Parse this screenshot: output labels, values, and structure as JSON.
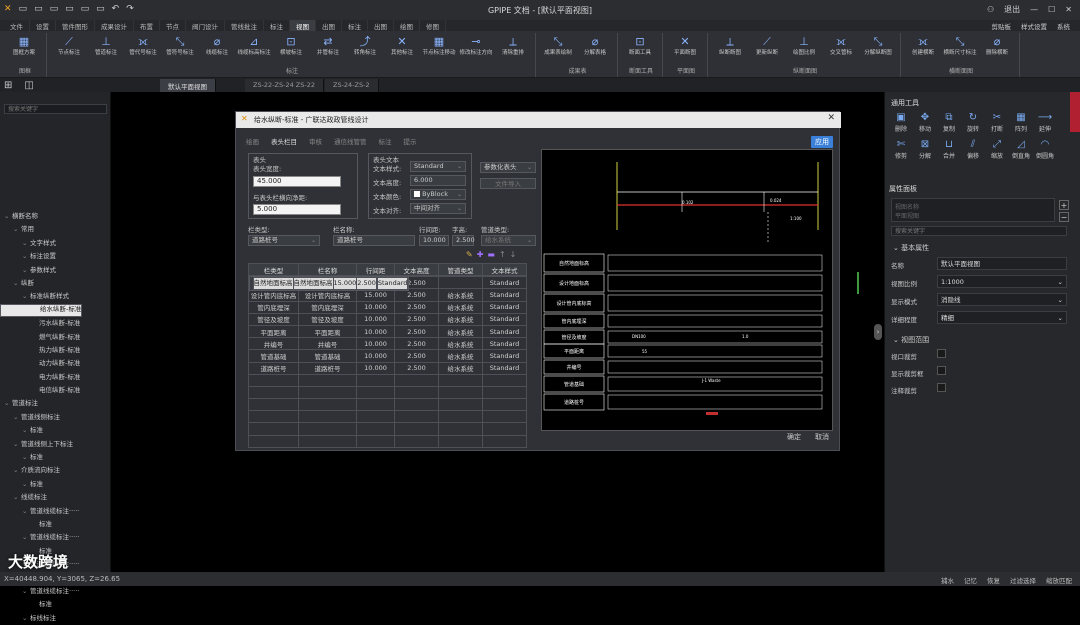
{
  "app": {
    "title": "GPIPE 文档 - [默认平面视图]",
    "logout": "退出",
    "shortcut": "剪贴板",
    "style_settings": "样式设置",
    "system": "系统"
  },
  "menu": [
    "文件",
    "设置",
    "管件图形",
    "成果设计",
    "布置",
    "节点",
    "阀门设计",
    "管线批注",
    "标注",
    "视图",
    "出图",
    "标注",
    "出图",
    "绘图",
    "修图"
  ],
  "ribbon_groups": [
    {
      "label": "图框",
      "buttons": [
        "图框方案"
      ]
    },
    {
      "label": "标注",
      "buttons": [
        "节点标注",
        "管道标注",
        "管代号标注",
        "管符号标注",
        "线缆标注",
        "线缆标高标注",
        "横坡标注",
        "井管标注",
        "转角标注",
        "其他标注",
        "节点标注移动",
        "修改标注方向",
        "清除重排"
      ]
    },
    {
      "label": "成果表",
      "buttons": [
        "成果表绘制",
        "分解表格"
      ]
    },
    {
      "label": "断面工具",
      "buttons": [
        "断面工具"
      ]
    },
    {
      "label": "平面图",
      "buttons": [
        "平面断图"
      ]
    },
    {
      "label": "纵断面图",
      "buttons": [
        "纵断断图",
        "更新纵断",
        "绘图比例",
        "交叉管标",
        "分解纵断图"
      ]
    },
    {
      "label": "横断面图",
      "buttons": [
        "创建横断",
        "横断尺寸标注",
        "删除横断"
      ]
    }
  ],
  "doc_tabs": [
    "默认平面视图",
    "ZS-22-ZS-24 ZS-22",
    "ZS-24-ZS-2"
  ],
  "left_search_placeholder": "搜索关键字",
  "tree": [
    {
      "t": "横断名称",
      "lvl": 0
    },
    {
      "t": "常用",
      "lvl": 1
    },
    {
      "t": "文字样式",
      "lvl": 2
    },
    {
      "t": "标注设置",
      "lvl": 2
    },
    {
      "t": "参数样式",
      "lvl": 2
    },
    {
      "t": "纵断",
      "lvl": 1
    },
    {
      "t": "标准纵断样式",
      "lvl": 2
    },
    {
      "t": "给水纵断-标准",
      "lvl": 3,
      "sel": true
    },
    {
      "t": "雨水纵断-标准",
      "lvl": 3
    },
    {
      "t": "污水纵断-标准",
      "lvl": 3
    },
    {
      "t": "燃气纵断-标准",
      "lvl": 3
    },
    {
      "t": "热力纵断-标准",
      "lvl": 3
    },
    {
      "t": "动力纵断-标准",
      "lvl": 3
    },
    {
      "t": "电力纵断-标准",
      "lvl": 3
    },
    {
      "t": "电信纵断-标准",
      "lvl": 3
    },
    {
      "t": "管道标注",
      "lvl": 0
    },
    {
      "t": "管道线侧标注",
      "lvl": 1
    },
    {
      "t": "标准",
      "lvl": 2
    },
    {
      "t": "管道线侧上下标注",
      "lvl": 1
    },
    {
      "t": "标准",
      "lvl": 2
    },
    {
      "t": "介质流向标注",
      "lvl": 1
    },
    {
      "t": "标准",
      "lvl": 2
    },
    {
      "t": "线缆标注",
      "lvl": 1
    },
    {
      "t": "管道线缆标注·····",
      "lvl": 2
    },
    {
      "t": "标准",
      "lvl": 3
    },
    {
      "t": "管道线缆标注·····",
      "lvl": 2
    },
    {
      "t": "标准",
      "lvl": 3
    },
    {
      "t": "管道线缆标注·····",
      "lvl": 2
    },
    {
      "t": "标准",
      "lvl": 3
    },
    {
      "t": "管道线缆标注·····",
      "lvl": 2
    },
    {
      "t": "标准",
      "lvl": 3
    },
    {
      "t": "标线标注",
      "lvl": 2
    }
  ],
  "status": {
    "coords": "X=40448.904, Y=3065, Z=26.65",
    "right_items": [
      "捕水",
      "记忆",
      "恢复",
      "过滤选择",
      "缩放匹配"
    ]
  },
  "watermark": "大数跨境",
  "dialog": {
    "title": "给水纵断-标准 - 广联达政政管线设计",
    "tabs": [
      "绘画",
      "表头栏目",
      "审核",
      "通信线管管",
      "标注",
      "提示"
    ],
    "apply": "应用",
    "header_box": "表头",
    "header_width_label": "表头宽度:",
    "header_width": "45.000",
    "header_gap_label": "与表头栏横向净距:",
    "header_gap": "5.000",
    "text_box": "表头文本",
    "text_style_label": "文本样式:",
    "text_style": "Standard",
    "text_height_label": "文本高度:",
    "text_height": "6.000",
    "text_color_label": "文本颜色:",
    "text_color": "ByBlock",
    "text_align_label": "文本对齐:",
    "text_align": "中间对齐",
    "param_header": "参数化表头",
    "import_btn": "文件导入",
    "col_type_label": "栏类型:",
    "col_type": "道路桩号",
    "col_name_label": "栏名称:",
    "col_name": "道路桩号",
    "row_gap_label": "行间距:",
    "row_gap": "10.000",
    "font_h_label": "字高:",
    "font_h": "2.500",
    "pipe_type_label": "管道类型:",
    "pipe_type": "给水系统",
    "table_headers": [
      "栏类型",
      "栏名称",
      "行间距",
      "文本高度",
      "管道类型",
      "文本样式"
    ],
    "table_rows": [
      [
        "自然地面标高",
        "自然地面标高",
        "15.000",
        "2.500",
        "",
        "Standard"
      ],
      [
        "设计地面标高",
        "设计地面标高",
        "15.000",
        "2.500",
        "",
        "Standard"
      ],
      [
        "设计管内底标高",
        "设计管内底标高",
        "15.000",
        "2.500",
        "给水系统",
        "Standard"
      ],
      [
        "管内底埋深",
        "管内底埋深",
        "10.000",
        "2.500",
        "给水系统",
        "Standard"
      ],
      [
        "管径及坡度",
        "管径及坡度",
        "10.000",
        "2.500",
        "给水系统",
        "Standard"
      ],
      [
        "平面距离",
        "平面距离",
        "10.000",
        "2.500",
        "给水系统",
        "Standard"
      ],
      [
        "井编号",
        "井编号",
        "10.000",
        "2.500",
        "给水系统",
        "Standard"
      ],
      [
        "管道基础",
        "管道基础",
        "10.000",
        "2.500",
        "给水系统",
        "Standard"
      ],
      [
        "道路桩号",
        "道路桩号",
        "10.000",
        "2.500",
        "给水系统",
        "Standard"
      ]
    ],
    "preview_rows": [
      "自然地面标高",
      "设计地面标高",
      "设计管内底标高",
      "管内底埋深",
      "管径及坡度",
      "平面距离",
      "井编号",
      "管道基础",
      "道路桩号"
    ],
    "preview_vals": {
      "a": "1:100",
      "b": "0.102",
      "c": "0.024",
      "d": "DN100",
      "e": "1.0",
      "f": "55",
      "g": "25",
      "h": "J-1 Waste",
      "i": "WS-1"
    },
    "ok": "确定",
    "cancel": "取消"
  },
  "right": {
    "common_tools": "通用工具",
    "tools": [
      "删除",
      "移动",
      "复制",
      "旋转",
      "打断",
      "阵列",
      "延伸",
      "修剪",
      "分解",
      "合并",
      "偏移",
      "缩放",
      "倒直角",
      "倒圆角"
    ],
    "props_title": "属性面板",
    "props_dropdown": "视图名称\n平面视图",
    "props_search": "搜索关键字",
    "basic_section": "基本属性",
    "name_label": "名称",
    "name_value": "默认平面视图",
    "scale_label": "视图比例",
    "scale_value": "1:1000",
    "display_label": "显示模式",
    "display_value": "消隐线",
    "detail_label": "详细程度",
    "detail_value": "精细",
    "range_section": "视图范围",
    "crop_label": "视口裁剪",
    "show_crop_label": "显示裁剪框",
    "annot_crop_label": "注释裁剪"
  }
}
